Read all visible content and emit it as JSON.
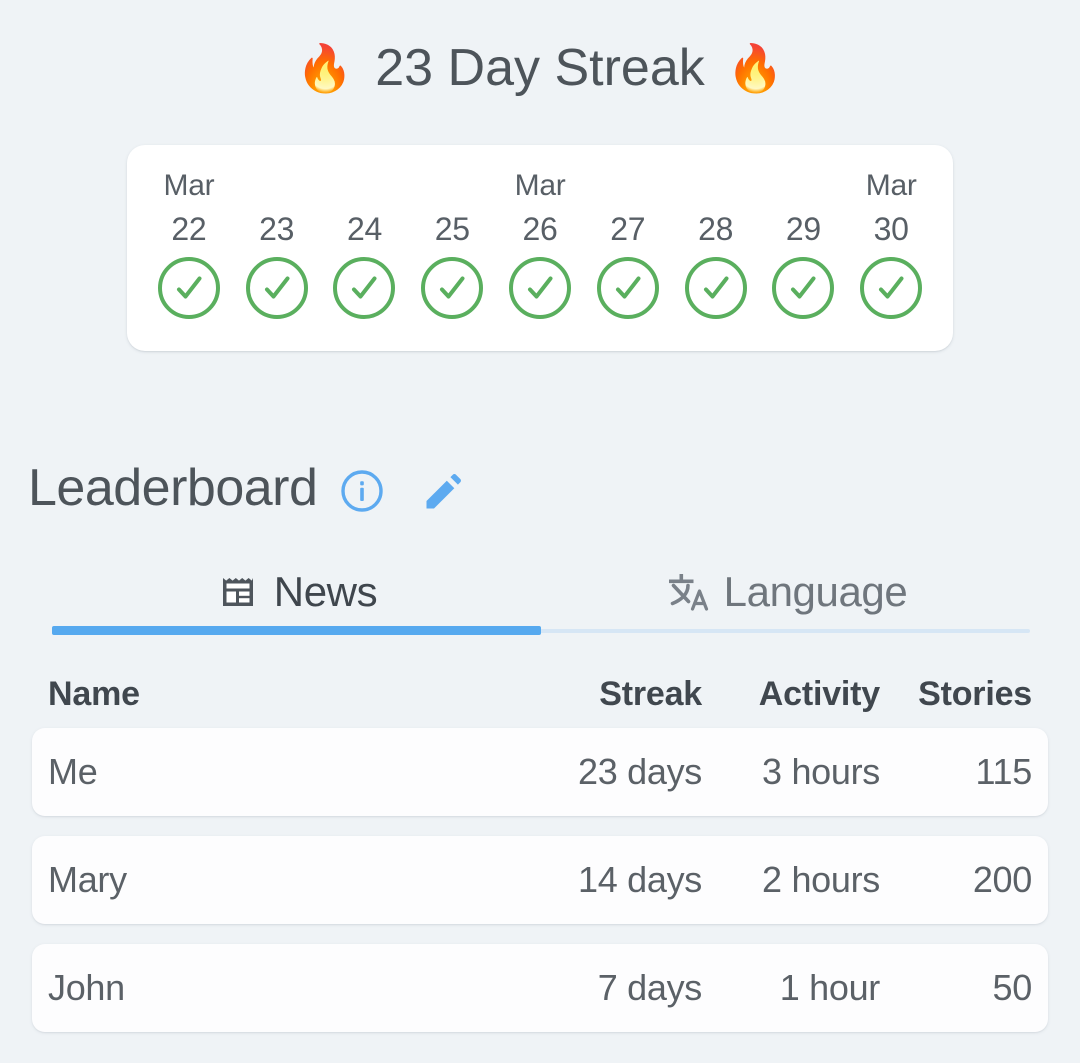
{
  "header": {
    "flame_icon_left": "fire-emoji",
    "flame_icon_right": "fire-emoji",
    "flame_glyph": "🔥",
    "streak_title": "23 Day Streak",
    "streak_days": 23
  },
  "calendar": {
    "days": [
      {
        "month": "Mar",
        "day": "22",
        "completed": true
      },
      {
        "month": "",
        "day": "23",
        "completed": true
      },
      {
        "month": "",
        "day": "24",
        "completed": true
      },
      {
        "month": "",
        "day": "25",
        "completed": true
      },
      {
        "month": "Mar",
        "day": "26",
        "completed": true
      },
      {
        "month": "",
        "day": "27",
        "completed": true
      },
      {
        "month": "",
        "day": "28",
        "completed": true
      },
      {
        "month": "",
        "day": "29",
        "completed": true
      },
      {
        "month": "Mar",
        "day": "30",
        "completed": true
      }
    ],
    "check_color": "#5aaf5e"
  },
  "leaderboard": {
    "title": "Leaderboard",
    "info_icon": "info-circle-icon",
    "edit_icon": "pencil-icon",
    "accent_color": "#56a9ef",
    "tabs": [
      {
        "label": "News",
        "icon": "newspaper-icon",
        "active": true
      },
      {
        "label": "Language",
        "icon": "translate-icon",
        "active": false
      }
    ],
    "columns": [
      "Name",
      "Streak",
      "Activity",
      "Stories"
    ],
    "rows": [
      {
        "name": "Me",
        "streak": "23 days",
        "activity": "3 hours",
        "stories": "115"
      },
      {
        "name": "Mary",
        "streak": "14 days",
        "activity": "2 hours",
        "stories": "200"
      },
      {
        "name": "John",
        "streak": "7 days",
        "activity": "1 hour",
        "stories": "50"
      }
    ]
  }
}
